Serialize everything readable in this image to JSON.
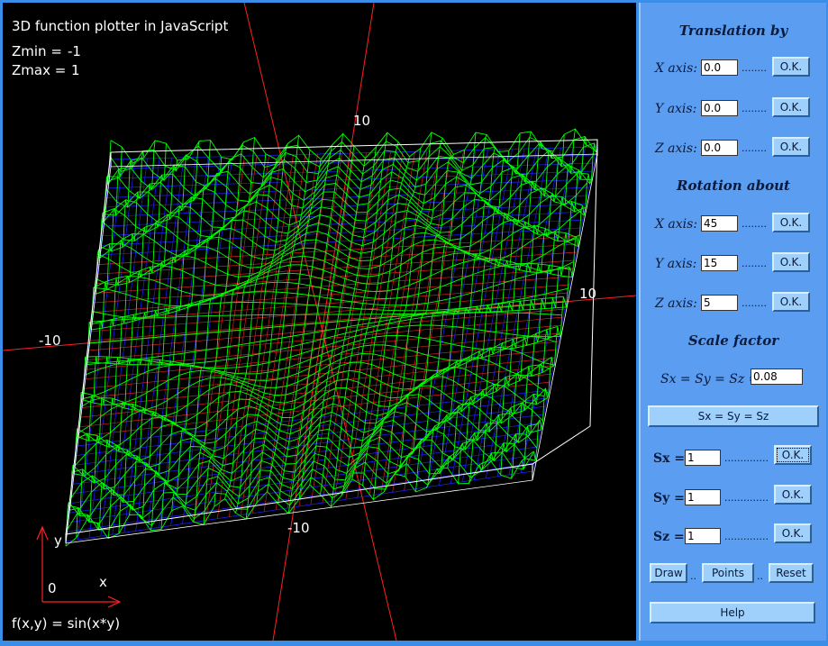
{
  "plot": {
    "title": "3D function plotter in JavaScript",
    "zmin_label": "Zmin =",
    "zmin_value": "-1",
    "zmax_label": "Zmax =",
    "zmax_value": "1",
    "function_label": "f(x,y) = sin(x*y)",
    "axis_tick_top": "10",
    "axis_tick_right": "10",
    "axis_tick_left": "-10",
    "axis_tick_bottom": "-10",
    "mini_axis_y": "y",
    "mini_axis_x": "x",
    "mini_axis_origin": "0",
    "colors": {
      "background": "#000000",
      "surface": "#00ff00",
      "axes": "#ff2020",
      "grid_blue": "#2020ff",
      "box": "#ffffff"
    }
  },
  "controls": {
    "translation_title": "Translation by",
    "rotation_title": "Rotation about",
    "scale_title": "Scale factor",
    "ok_label": "O.K.",
    "dots": "........",
    "dots_long": "..............",
    "translation": [
      {
        "label": "X axis:",
        "value": "0.0"
      },
      {
        "label": "Y axis:",
        "value": "0.0"
      },
      {
        "label": "Z axis:",
        "value": "0.0"
      }
    ],
    "rotation": [
      {
        "label": "X axis:",
        "value": "45"
      },
      {
        "label": "Y axis:",
        "value": "15"
      },
      {
        "label": "Z axis:",
        "value": "5"
      }
    ],
    "uniform_scale_label": "Sx = Sy = Sz =",
    "uniform_scale_value": "0.08",
    "uniform_scale_button": "Sx = Sy = Sz",
    "scales": [
      {
        "label": "Sx =",
        "value": "1"
      },
      {
        "label": "Sy =",
        "value": "1"
      },
      {
        "label": "Sz =",
        "value": "1"
      }
    ],
    "draw_button": "Draw",
    "points_button": "Points",
    "reset_button": "Reset",
    "help_button": "Help",
    "sep": ".."
  }
}
